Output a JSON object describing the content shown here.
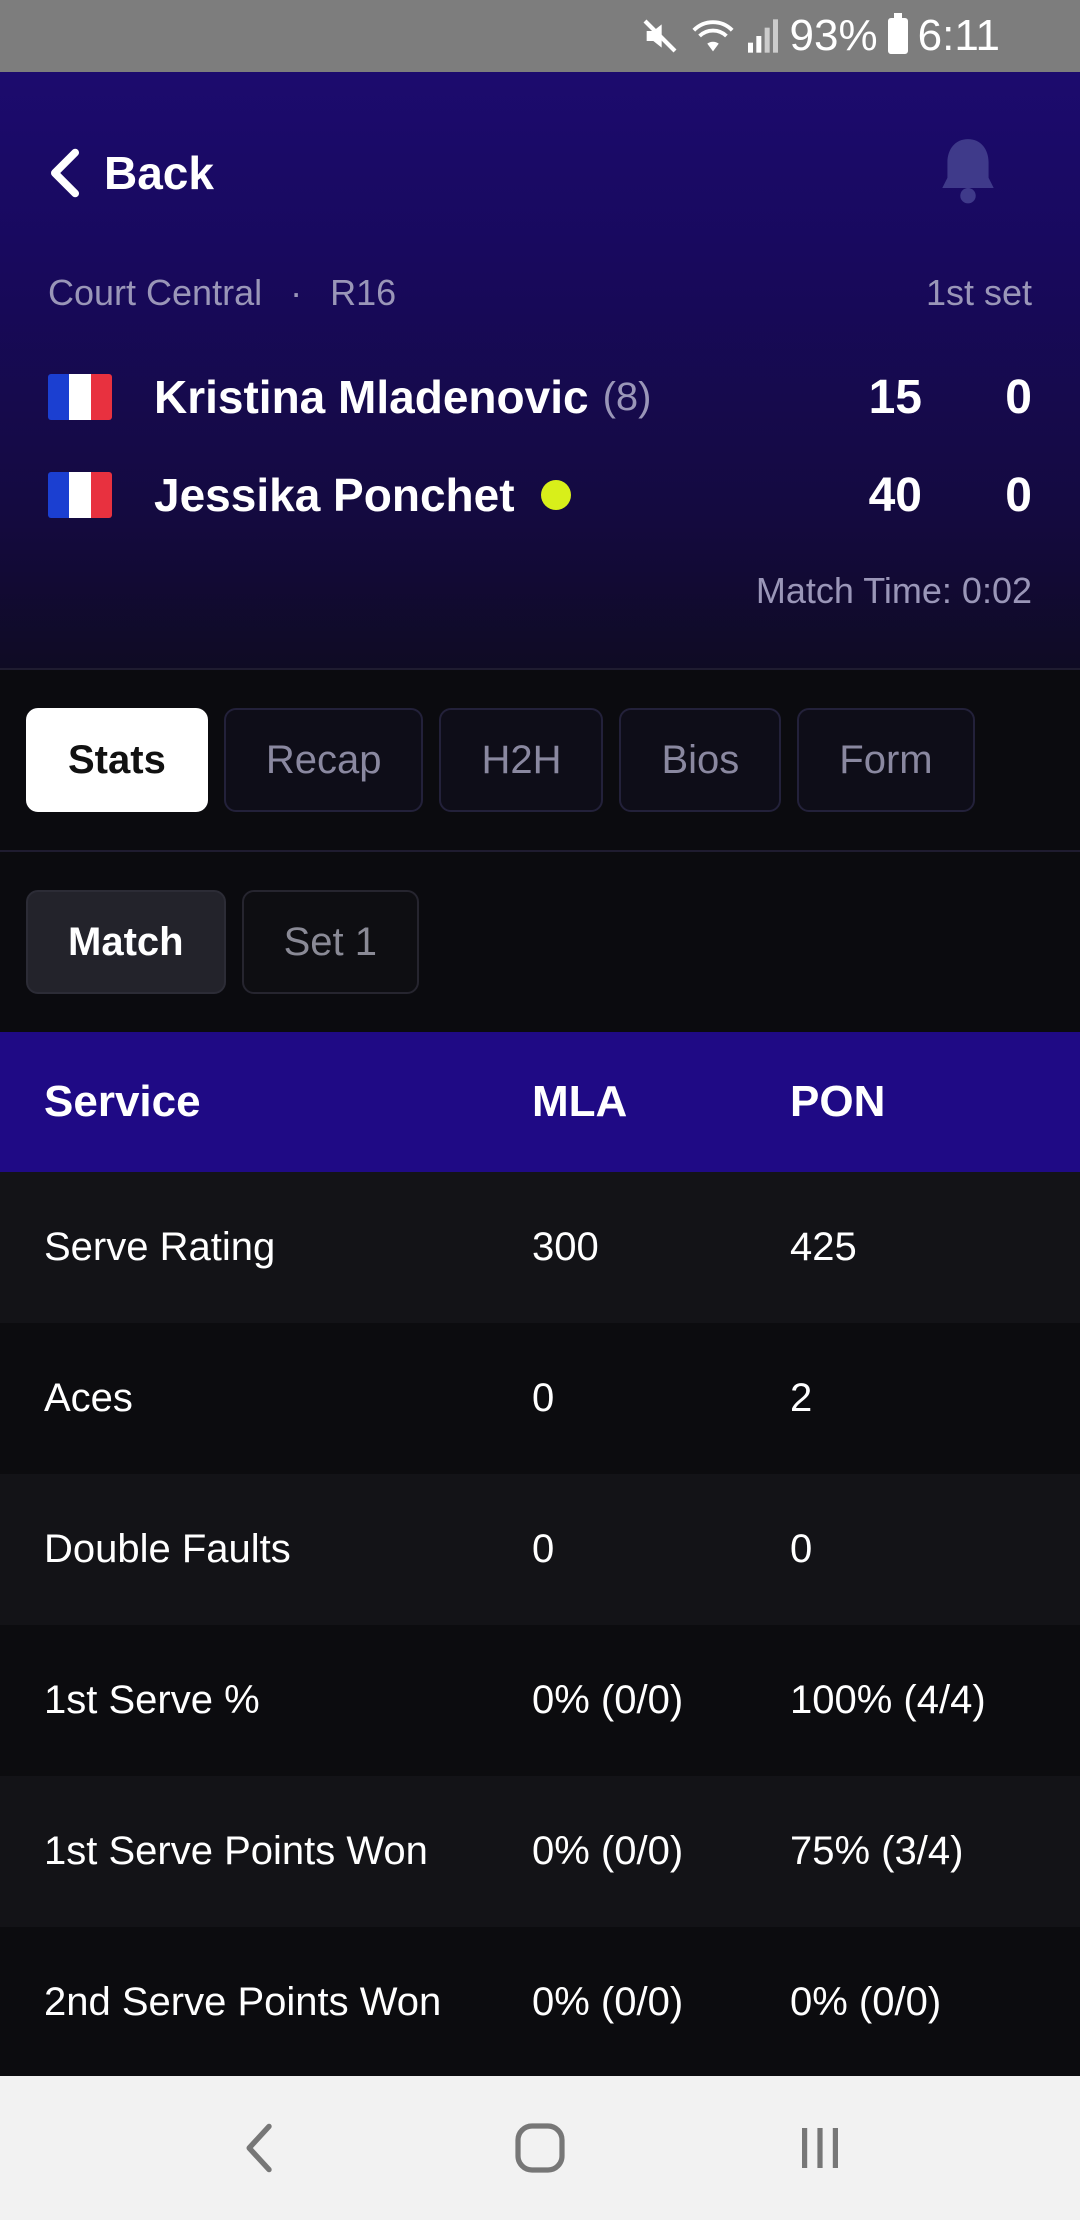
{
  "status_bar": {
    "battery": "93%",
    "time": "6:11"
  },
  "header": {
    "back_label": "Back",
    "court": "Court Central",
    "separator": "·",
    "round": "R16",
    "set_label": "1st set",
    "match_time": "Match Time: 0:02"
  },
  "players": [
    {
      "name": "Kristina Mladenovic",
      "seed": "(8)",
      "points": "15",
      "set1": "0",
      "serving": false
    },
    {
      "name": "Jessika Ponchet",
      "seed": "",
      "points": "40",
      "set1": "0",
      "serving": true
    }
  ],
  "tabs": [
    "Stats",
    "Recap",
    "H2H",
    "Bios",
    "Form"
  ],
  "subtabs": [
    "Match",
    "Set 1"
  ],
  "table": {
    "headers": [
      "Service",
      "MLA",
      "PON"
    ],
    "rows": [
      [
        "Serve Rating",
        "300",
        "425"
      ],
      [
        "Aces",
        "0",
        "2"
      ],
      [
        "Double Faults",
        "0",
        "0"
      ],
      [
        "1st Serve %",
        "0% (0/0)",
        "100% (4/4)"
      ],
      [
        "1st Serve Points Won",
        "0% (0/0)",
        "75% (3/4)"
      ],
      [
        "2nd Serve Points Won",
        "0% (0/0)",
        "0% (0/0)"
      ]
    ]
  },
  "colors": {
    "header_bg": "#1c0b6e",
    "table_header_bg": "#1f0a85",
    "serve_dot": "#d8ef1a"
  }
}
